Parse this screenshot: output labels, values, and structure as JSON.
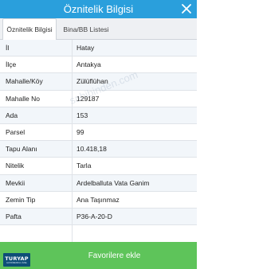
{
  "window": {
    "title": "Öznitelik Bilgisi",
    "close_icon": "close-icon"
  },
  "tabs": [
    {
      "label": "Öznitelik Bilgisi",
      "active": true
    },
    {
      "label": "Bina/BB Listesi",
      "active": false
    }
  ],
  "rows": [
    {
      "key": "İl",
      "value": "Hatay"
    },
    {
      "key": "İlçe",
      "value": "Antakya"
    },
    {
      "key": "Mahalle/Köy",
      "value": "Zülüflühan"
    },
    {
      "key": "Mahalle No",
      "value": "129187"
    },
    {
      "key": "Ada",
      "value": "153"
    },
    {
      "key": "Parsel",
      "value": "99"
    },
    {
      "key": "Tapu Alanı",
      "value": "10.418,18"
    },
    {
      "key": "Nitelik",
      "value": "Tarla"
    },
    {
      "key": "Mevkii",
      "value": "Ardelballuta Vata Ganim"
    },
    {
      "key": "Zemin Tip",
      "value": "Ana Taşınmaz"
    },
    {
      "key": "Pafta",
      "value": "P36-A-20-D"
    }
  ],
  "watermark": "sahibinden.com",
  "footer": {
    "button_label": "Favorilere ekle",
    "logo_text": "TURYAP",
    "logo_subtext": "GAYRİMENKUL ÖZEL",
    "bar_color": "#5ec45a"
  },
  "colors": {
    "title_bar": "#2a9fdc",
    "row_alt": "#f2f6fa"
  }
}
